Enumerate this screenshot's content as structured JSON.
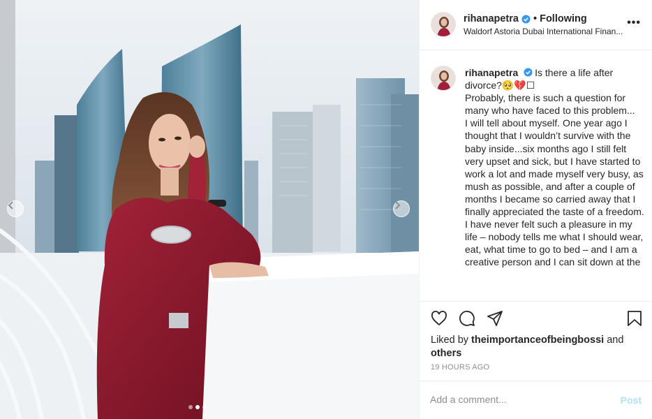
{
  "post": {
    "username": "rihanapetra",
    "follow_status": "• Following",
    "location": "Waldorf Astoria Dubai International Finan...",
    "more_label": "•••",
    "caption_user": "rihanapetra",
    "caption_text": "Is there a life after divorce?🥺💔☐\nProbably, there is such a question for many who have faced to this problem...\nI will tell about myself. One year ago I thought that I wouldn’t survive with the baby inside...six months ago I still felt very upset and sick, but I have started to work a lot and made myself very busy, as mush as possible, and after a couple of months I became so carried away that I finally appreciated the taste of a freedom. I have never felt such a pleasure in my life – nobody tells me what I should wear, eat, what time to go to bed – and I am a creative person and I can sit down at the",
    "liked_by_prefix": "Liked by ",
    "liked_by_user": "theimportanceofbeingbossi",
    "liked_by_middle": " and ",
    "liked_by_others": "others",
    "time_ago": "19 HOURS AGO",
    "comment_placeholder": "Add a comment...",
    "post_label": "Post"
  },
  "icons": {
    "like": "heart-icon",
    "comment": "comment-icon",
    "share": "paper-plane-icon",
    "save": "bookmark-icon",
    "verified": "verified-badge-icon",
    "prev": "chevron-left-icon",
    "next": "chevron-right-icon"
  },
  "colors": {
    "verified": "#3897f0",
    "post_button": "#b2dffc",
    "secondary_text": "#8e8e8e",
    "dress": "#8e1a2c"
  }
}
